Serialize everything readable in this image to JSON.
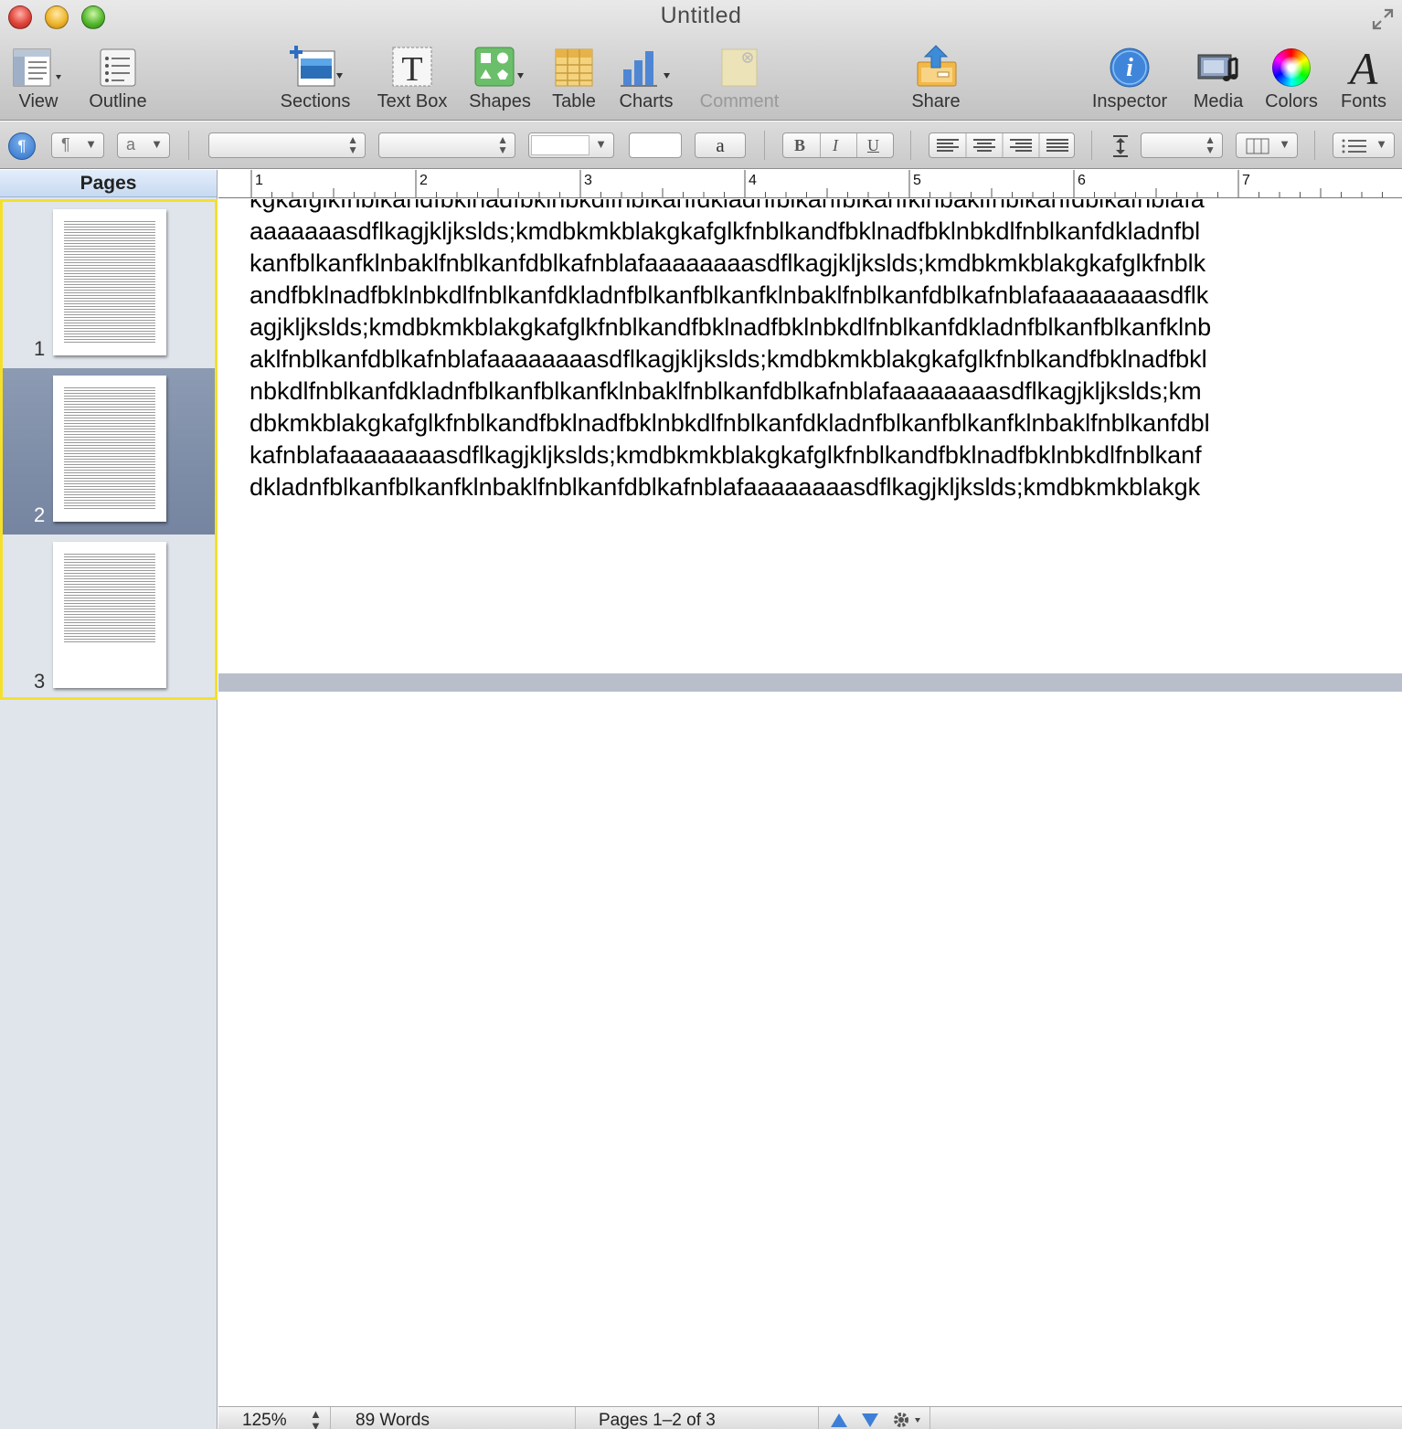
{
  "window": {
    "title": "Untitled"
  },
  "toolbar": {
    "items": [
      {
        "label": "View",
        "icon": "view-icon"
      },
      {
        "label": "Outline",
        "icon": "outline-icon"
      },
      {
        "label": "Sections",
        "icon": "sections-icon"
      },
      {
        "label": "Text Box",
        "icon": "text-box-icon"
      },
      {
        "label": "Shapes",
        "icon": "shapes-icon"
      },
      {
        "label": "Table",
        "icon": "table-icon"
      },
      {
        "label": "Charts",
        "icon": "charts-icon"
      },
      {
        "label": "Comment",
        "icon": "comment-icon",
        "disabled": true
      },
      {
        "label": "Share",
        "icon": "share-icon"
      },
      {
        "label": "Inspector",
        "icon": "inspector-icon"
      },
      {
        "label": "Media",
        "icon": "media-icon"
      },
      {
        "label": "Colors",
        "icon": "colors-icon"
      },
      {
        "label": "Fonts",
        "icon": "fonts-icon"
      }
    ]
  },
  "formatbar": {
    "paragraph_style_glyph": "¶",
    "char_style_glyph": "a",
    "text_sample": "a",
    "bold": "B",
    "italic": "I",
    "underline": "U"
  },
  "sidebar": {
    "header": "Pages",
    "pages": [
      {
        "number": "1",
        "selected": false
      },
      {
        "number": "2",
        "selected": true
      },
      {
        "number": "3",
        "selected": false
      }
    ]
  },
  "ruler": {
    "labels": [
      "1",
      "2",
      "3",
      "4",
      "5",
      "6",
      "7"
    ]
  },
  "document": {
    "lines": [
      "kgkafglkfnblkandfbklnadfbklnbkdlfnblkanfdkladnfblkanfblkanfklnbaklfnblkanfdblkafnblafa",
      "aaaaaaasdflkagjkljkslds;kmdbkmkblakgkafglkfnblkandfbklnadfbklnbkdlfnblkanfdkladnfbl",
      "kanfblkanfklnbaklfnblkanfdblkafnblafaaaaaaaasdflkagjkljkslds;kmdbkmkblakgkafglkfnblk",
      "andfbklnadfbklnbkdlfnblkanfdkladnfblkanfblkanfklnbaklfnblkanfdblkafnblafaaaaaaaasdflk",
      "agjkljkslds;kmdbkmkblakgkafglkfnblkandfbklnadfbklnbkdlfnblkanfdkladnfblkanfblkanfklnb",
      "aklfnblkanfdblkafnblafaaaaaaaasdflkagjkljkslds;kmdbkmkblakgkafglkfnblkandfbklnadfbkl",
      "nbkdlfnblkanfdkladnfblkanfblkanfklnbaklfnblkanfdblkafnblafaaaaaaaasdflkagjkljkslds;km",
      "dbkmkblakgkafglkfnblkandfbklnadfbklnbkdlfnblkanfdkladnfblkanfblkanfklnbaklfnblkanfdbl",
      "kafnblafaaaaaaaasdflkagjkljkslds;kmdbkmkblakgkafglkfnblkandfbklnadfbklnbkdlfnblkanf",
      "dkladnfblkanfblkanfklnbaklfnblkanfdblkafnblafaaaaaaaasdflkagjkljkslds;kmdbkmkblakgk"
    ]
  },
  "statusbar": {
    "zoom": "125%",
    "word_count": "89 Words",
    "page_indicator": "Pages 1–2 of 3"
  },
  "colors": {
    "selection_border": "#f4e02a",
    "selected_thumb": "#7f8ea8",
    "page_gap": "#b8bfca"
  }
}
